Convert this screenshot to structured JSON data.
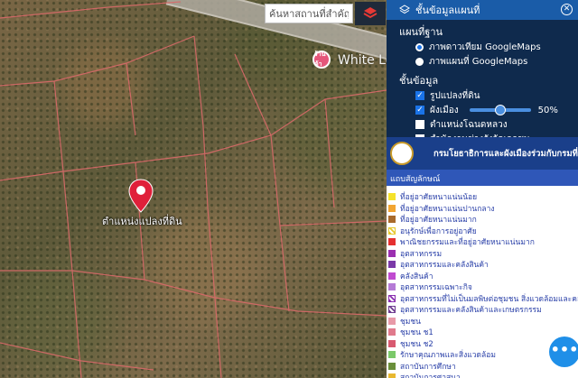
{
  "map": {
    "poi_badge": "ร้านค้า",
    "poi_label": "White Lo",
    "pin_label": "ตำแหน่งแปลงที่ดิน"
  },
  "search": {
    "placeholder": "ค้นหาสถานที่สำคัญ"
  },
  "panel": {
    "title": "ชั้นข้อมูลแผนที่",
    "basemap_title": "แผนที่ฐาน",
    "basemaps": [
      {
        "label": "ภาพดาวเทียม GoogleMaps",
        "selected": true
      },
      {
        "label": "ภาพแผนที่ GoogleMaps",
        "selected": false
      }
    ],
    "layers_title": "ชั้นข้อมูล",
    "layers": [
      {
        "label": "รูปแปลงที่ดิน",
        "checked": true
      },
      {
        "label": "ผังเมือง",
        "checked": true,
        "opacity_percent": 50,
        "opacity_label": "50%"
      },
      {
        "label": "ตำแหน่งโฉนดหลวง",
        "checked": false
      },
      {
        "label": "สำนักงานช่างรังวัดเอกชน",
        "checked": false
      }
    ]
  },
  "banner": {
    "text": "กรมโยธาธิการและผังเมืองร่วมกับกรมที่ดิน"
  },
  "legend": {
    "title": "แถบสัญลักษณ์",
    "items": [
      {
        "label": "ที่อยู่อาศัยหนาแน่นน้อย",
        "color": "#f5e22a",
        "hatch": false
      },
      {
        "label": "ที่อยู่อาศัยหนาแน่นปานกลาง",
        "color": "#f2a531",
        "hatch": false
      },
      {
        "label": "ที่อยู่อาศัยหนาแน่นมาก",
        "color": "#a86a2c",
        "hatch": false
      },
      {
        "label": "อนุรักษ์เพื่อการอยู่อาศัย",
        "color": "#e6c82e",
        "hatch": true
      },
      {
        "label": "พาณิชยกรรมและที่อยู่อาศัยหนาแน่นมาก",
        "color": "#e53030",
        "hatch": false
      },
      {
        "label": "อุตสาหกรรม",
        "color": "#9b2fb0",
        "hatch": false
      },
      {
        "label": "อุตสาหกรรมและคลังสินค้า",
        "color": "#7b3aa8",
        "hatch": false
      },
      {
        "label": "คลังสินค้า",
        "color": "#c04bd0",
        "hatch": false
      },
      {
        "label": "อุตสาหกรรมเฉพาะกิจ",
        "color": "#b57bd6",
        "hatch": false
      },
      {
        "label": "อุตสาหกรรมที่ไม่เป็นมลพิษต่อชุมชน สิ่งแวดล้อมและคลังสินค้า",
        "color": "#8a2fb0",
        "hatch": true
      },
      {
        "label": "อุตสาหกรรมและคลังสินค้าและเกษตรกรรม",
        "color": "#6e3b8f",
        "hatch": true
      },
      {
        "label": "ชุมชน",
        "color": "#e89aa8",
        "hatch": false
      },
      {
        "label": "ชุมชน ช1",
        "color": "#e07a8c",
        "hatch": false
      },
      {
        "label": "ชุมชน ช2",
        "color": "#d85a70",
        "hatch": false
      },
      {
        "label": "รักษาคุณภาพและสิ่งแวดล้อม",
        "color": "#7bc96a",
        "hatch": false
      },
      {
        "label": "สถาบันการศึกษา",
        "color": "#6a8f3a",
        "hatch": false
      },
      {
        "label": "สถาบันการศาสนา",
        "color": "#e8b830",
        "hatch": false
      }
    ]
  },
  "fab": {
    "label": "•••"
  }
}
